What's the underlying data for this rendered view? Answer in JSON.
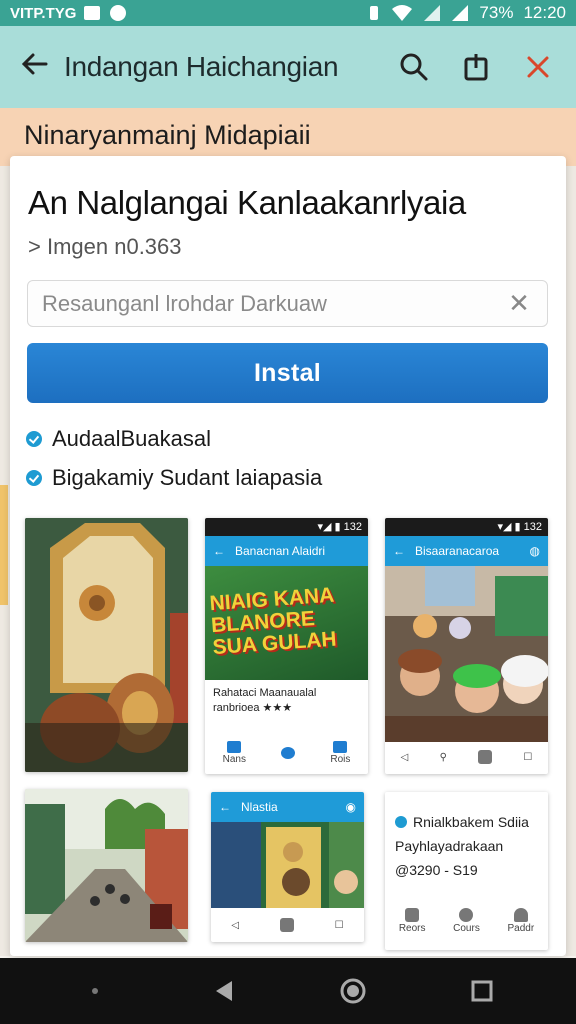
{
  "status_bar": {
    "carrier": "VITP.TYG",
    "battery": "73%",
    "time": "12:20"
  },
  "app_bar": {
    "title": "Indangan Haichangian"
  },
  "subheader": {
    "text": "Ninaryanmainj Midapiaii"
  },
  "sheet": {
    "title": "An Nalglangai Kanlaakanrlyaia",
    "subtitle": "> Imgen n0.363",
    "search_placeholder": "Resaunganl lrohdar Darkuaw",
    "install_label": "Instal",
    "features": [
      "AudaalBuakasal",
      "Bigakamiy Sudant laiapasia"
    ]
  },
  "gallery": {
    "shot2": {
      "status": "▾◢ ▮ 132",
      "bar_title": "Banacnan Alaidri",
      "poster_text": "NIAIG KANA BLANORE SUA GULAH",
      "caption_line1": "Rahataci Maanaualal",
      "caption_line2": "ranbrioea ★★★",
      "nav": [
        "Nans",
        "",
        "Rois"
      ]
    },
    "shot3": {
      "status": "▾◢ ▮ 132",
      "bar_title": "Bisaaranacaroa"
    },
    "shot5": {
      "bar_title": "Nlastia"
    },
    "shot6": {
      "line1": "Rnialkbakem Sdiia",
      "line2": "Payhlayadrakaan",
      "line3": "@3290 - S19",
      "nav": [
        "Reors",
        "Cours",
        "Paddr"
      ]
    }
  },
  "colors": {
    "status_bar": "#3aa394",
    "app_bar": "#a9ddd9",
    "subheader": "#f7d3b4",
    "install": "#1d6fc0",
    "check": "#1e9bd2"
  }
}
